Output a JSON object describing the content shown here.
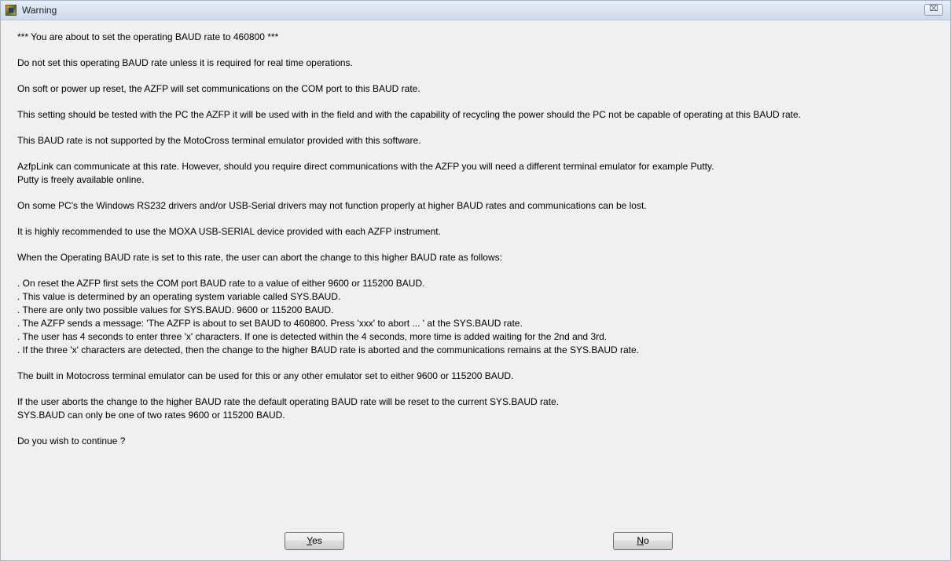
{
  "window": {
    "title": "Warning",
    "close_glyph": "⌧",
    "icon": "app-icon"
  },
  "message": {
    "line1": "*** You are about to set the operating BAUD rate to 460800 ***",
    "line2": "Do not set this operating BAUD rate unless it is required for real time operations.",
    "line3": "On soft or power up reset, the AZFP will set communications on the COM port to this BAUD rate.",
    "line4": "This setting should be tested with the PC the AZFP it will be used with in the field and with the capability of recycling the power should the PC not be capable of operating at this BAUD rate.",
    "line5": "This BAUD rate is not supported by the MotoCross terminal emulator provided with this software.",
    "line6a": "AzfpLink can communicate at this rate. However, should you require direct communications with the AZFP you will need a different terminal emulator for example Putty.",
    "line6b": "Putty is freely available online.",
    "line7": "On some PC's the Windows RS232 drivers and/or USB-Serial drivers may not function properly at higher BAUD rates and communications can be lost.",
    "line8": "It is highly recommended to use the MOXA USB-SERIAL device provided with each AZFP instrument.",
    "line9": "When the Operating BAUD rate is set to this rate, the user can abort the change to this higher BAUD rate as follows:",
    "steps": [
      ". On reset the AZFP first sets the COM port BAUD rate to a value of either 9600 or 115200 BAUD.",
      ". This value is determined by an operating system variable called SYS.BAUD.",
      ". There are only two possible values for SYS.BAUD. 9600 or 115200 BAUD.",
      ". The AZFP sends a message: 'The AZFP is about to set BAUD to 460800. Press 'xxx' to abort ... ' at the SYS.BAUD rate.",
      ". The user has 4 seconds to enter three 'x' characters. If one is detected within the 4 seconds, more time is added waiting for the 2nd and 3rd.",
      ". If the three 'x' characters are detected, then the change to the higher BAUD rate is aborted and the communications remains at the SYS.BAUD rate."
    ],
    "line10": "The built in Motocross terminal emulator can be used for this or any other emulator set to either 9600 or 115200 BAUD.",
    "line11a": "If the user aborts the change to the higher BAUD rate the default operating BAUD rate will be reset to the current SYS.BAUD rate.",
    "line11b": "SYS.BAUD can only be one of two rates 9600 or 115200 BAUD.",
    "question": "Do you wish to continue ?"
  },
  "buttons": {
    "yes": {
      "mnemonic": "Y",
      "rest": "es"
    },
    "no": {
      "mnemonic": "N",
      "rest": "o"
    }
  }
}
